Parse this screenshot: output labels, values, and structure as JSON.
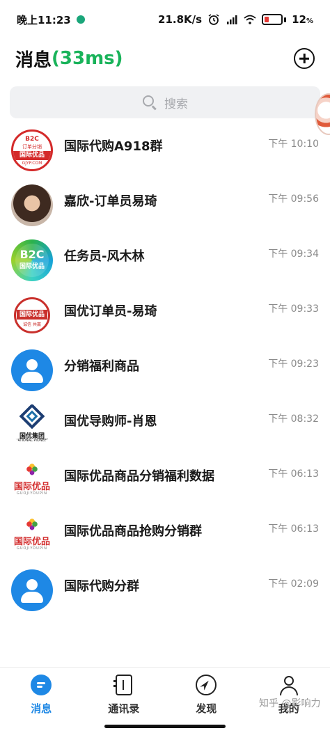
{
  "status_bar": {
    "time": "晚上11:23",
    "network_speed": "21.8K/s",
    "battery_percent": "12",
    "battery_suffix": "%"
  },
  "header": {
    "title": "消息",
    "latency": "(33ms)"
  },
  "search": {
    "placeholder": "搜索"
  },
  "chats": [
    {
      "name": "国际代购A918群",
      "time": "下午 10:10",
      "avatar": "b2c-red-logo"
    },
    {
      "name": "嘉欣-订单员易琦",
      "time": "下午 09:56",
      "avatar": "photo"
    },
    {
      "name": "任务员-风木林",
      "time": "下午 09:34",
      "avatar": "b2c-green-logo"
    },
    {
      "name": "国优订单员-易琦",
      "time": "下午 09:33",
      "avatar": "guoyou-logo"
    },
    {
      "name": "分销福利商品",
      "time": "下午 09:23",
      "avatar": "default-user"
    },
    {
      "name": "国优导购师-肖恩",
      "time": "下午 08:32",
      "avatar": "jituan-logo"
    },
    {
      "name": "国际优品商品分销福利数据",
      "time": "下午 06:13",
      "avatar": "youpin-logo"
    },
    {
      "name": "国际优品商品抢购分销群",
      "time": "下午 06:13",
      "avatar": "youpin-logo"
    },
    {
      "name": "国际代购分群",
      "time": "下午 02:09",
      "avatar": "default-user"
    }
  ],
  "avatar_text": {
    "b2c_red": {
      "line1": "B2C",
      "line2": "订单分销",
      "band": "国际优品",
      "line3": "GJYP.COM"
    },
    "b2c_green": {
      "line1": "B2C",
      "line2": "国际优品"
    },
    "guoyou": {
      "band": "国际优品",
      "line": "诚信 共赢"
    },
    "jituan": {
      "line1": "国优集团",
      "line2": "NATIONAL PIONEER"
    },
    "youpin": {
      "line1": "国际优品",
      "line2": "GUOJIYOUPIN"
    }
  },
  "bottom_nav": {
    "items": [
      {
        "label": "消息",
        "icon": "chat-bubble-icon",
        "active": true
      },
      {
        "label": "通讯录",
        "icon": "contacts-book-icon",
        "active": false
      },
      {
        "label": "发现",
        "icon": "compass-icon",
        "active": false
      },
      {
        "label": "我的",
        "icon": "person-icon",
        "active": false
      }
    ]
  },
  "watermark": "知乎 @影响力",
  "colors": {
    "accent": "#1e88e5",
    "latency": "#19b35a",
    "time_text": "#8a8a8a"
  }
}
